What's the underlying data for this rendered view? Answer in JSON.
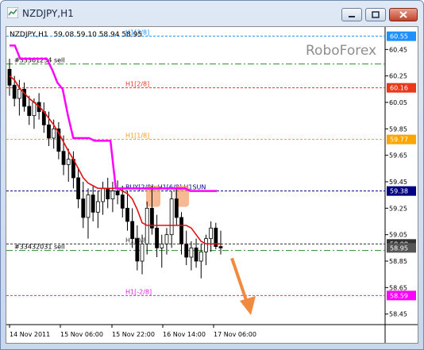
{
  "window": {
    "title": "NZDJPY,H1"
  },
  "chart_header": {
    "symbol": "NZDJPY,H1",
    "ohlc": "59.08 59.10 58.94 58.95"
  },
  "watermark": "RoboForex",
  "orders": [
    {
      "label": "#33361234 sell",
      "price": 60.34
    },
    {
      "label": "#33432031 sell",
      "price": 58.93
    }
  ],
  "levels": [
    {
      "label": "H1[3/8]",
      "price": 60.55,
      "color": "#1e90ff"
    },
    {
      "label": "H1[2/8]",
      "price": 60.16,
      "color": "#e8391d"
    },
    {
      "label": "H1[1/8]",
      "price": 59.77,
      "color": "#ff9a1a"
    },
    {
      "label": "BUY[2/8]: H1[6/8]  H1SUN",
      "price": 59.38,
      "color": "#00008b"
    },
    {
      "label": "H1[0/8]",
      "price": 58.98,
      "color": "#333333"
    },
    {
      "label": "H1[-2/8]",
      "price": 58.59,
      "color": "#e020e0"
    }
  ],
  "price_badges": [
    {
      "text": "60.55",
      "color": "#1e90ff"
    },
    {
      "text": "60.16",
      "color": "#e8391d"
    },
    {
      "text": "59.77",
      "color": "#ffa500"
    },
    {
      "text": "59.38",
      "color": "#000080"
    },
    {
      "text": "58.98",
      "color": "#333333"
    },
    {
      "text": "58.95",
      "color": "#555555"
    },
    {
      "text": "58.59",
      "color": "#ff00ff"
    }
  ],
  "chart_data": {
    "type": "candlestick",
    "symbol": "NZDJPY",
    "timeframe": "H1",
    "y_ticks": [
      "60.45",
      "60.25",
      "60.05",
      "59.85",
      "59.65",
      "59.45",
      "59.25",
      "59.05",
      "58.85",
      "58.65",
      "58.45"
    ],
    "y_tick_values": [
      60.45,
      60.25,
      60.05,
      59.85,
      59.65,
      59.45,
      59.25,
      59.05,
      58.85,
      58.65,
      58.45
    ],
    "ylim": [
      58.37,
      60.62
    ],
    "x_ticks": [
      "14 Nov 2011",
      "15 Nov 06:00",
      "15 Nov 22:00",
      "16 Nov 14:00",
      "17 Nov 06:00"
    ],
    "candles": [
      {
        "o": 60.3,
        "h": 60.38,
        "l": 60.1,
        "c": 60.18
      },
      {
        "o": 60.18,
        "h": 60.25,
        "l": 60.02,
        "c": 60.08
      },
      {
        "o": 60.08,
        "h": 60.22,
        "l": 59.95,
        "c": 60.15
      },
      {
        "o": 60.15,
        "h": 60.2,
        "l": 59.98,
        "c": 60.02
      },
      {
        "o": 60.02,
        "h": 60.1,
        "l": 59.88,
        "c": 59.95
      },
      {
        "o": 59.95,
        "h": 60.08,
        "l": 59.85,
        "c": 60.05
      },
      {
        "o": 60.05,
        "h": 60.12,
        "l": 59.92,
        "c": 59.98
      },
      {
        "o": 59.98,
        "h": 60.05,
        "l": 59.82,
        "c": 59.88
      },
      {
        "o": 59.88,
        "h": 59.98,
        "l": 59.72,
        "c": 59.78
      },
      {
        "o": 59.78,
        "h": 59.92,
        "l": 59.7,
        "c": 59.85
      },
      {
        "o": 59.85,
        "h": 59.9,
        "l": 59.62,
        "c": 59.68
      },
      {
        "o": 59.68,
        "h": 59.8,
        "l": 59.5,
        "c": 59.58
      },
      {
        "o": 59.58,
        "h": 59.7,
        "l": 59.45,
        "c": 59.62
      },
      {
        "o": 59.62,
        "h": 59.68,
        "l": 59.4,
        "c": 59.48
      },
      {
        "o": 59.48,
        "h": 59.55,
        "l": 59.25,
        "c": 59.32
      },
      {
        "o": 59.32,
        "h": 59.45,
        "l": 59.1,
        "c": 59.18
      },
      {
        "o": 59.18,
        "h": 59.4,
        "l": 59.02,
        "c": 59.35
      },
      {
        "o": 59.35,
        "h": 59.42,
        "l": 59.15,
        "c": 59.22
      },
      {
        "o": 59.22,
        "h": 59.38,
        "l": 59.1,
        "c": 59.3
      },
      {
        "o": 59.3,
        "h": 59.45,
        "l": 59.2,
        "c": 59.4
      },
      {
        "o": 59.4,
        "h": 59.48,
        "l": 59.25,
        "c": 59.32
      },
      {
        "o": 59.32,
        "h": 59.45,
        "l": 59.22,
        "c": 59.38
      },
      {
        "o": 59.38,
        "h": 59.46,
        "l": 59.28,
        "c": 59.35
      },
      {
        "o": 59.35,
        "h": 59.42,
        "l": 59.18,
        "c": 59.25
      },
      {
        "o": 59.25,
        "h": 59.38,
        "l": 59.08,
        "c": 59.15
      },
      {
        "o": 59.15,
        "h": 59.25,
        "l": 58.95,
        "c": 59.02
      },
      {
        "o": 59.02,
        "h": 59.12,
        "l": 58.78,
        "c": 58.85
      },
      {
        "o": 58.85,
        "h": 59.05,
        "l": 58.75,
        "c": 58.98
      },
      {
        "o": 58.98,
        "h": 59.3,
        "l": 58.9,
        "c": 59.25
      },
      {
        "o": 59.25,
        "h": 59.42,
        "l": 59.05,
        "c": 59.1
      },
      {
        "o": 59.1,
        "h": 59.2,
        "l": 58.88,
        "c": 58.95
      },
      {
        "o": 58.95,
        "h": 59.05,
        "l": 58.8,
        "c": 58.98
      },
      {
        "o": 58.98,
        "h": 59.1,
        "l": 58.9,
        "c": 59.05
      },
      {
        "o": 59.05,
        "h": 59.38,
        "l": 58.95,
        "c": 59.32
      },
      {
        "o": 59.32,
        "h": 59.4,
        "l": 59.12,
        "c": 59.18
      },
      {
        "o": 59.18,
        "h": 59.22,
        "l": 58.9,
        "c": 58.98
      },
      {
        "o": 58.98,
        "h": 59.08,
        "l": 58.82,
        "c": 58.88
      },
      {
        "o": 58.88,
        "h": 59.0,
        "l": 58.78,
        "c": 58.95
      },
      {
        "o": 58.95,
        "h": 59.02,
        "l": 58.8,
        "c": 58.85
      },
      {
        "o": 58.85,
        "h": 58.98,
        "l": 58.72,
        "c": 58.92
      },
      {
        "o": 58.92,
        "h": 59.05,
        "l": 58.82,
        "c": 59.02
      },
      {
        "o": 59.02,
        "h": 59.15,
        "l": 58.92,
        "c": 59.1
      },
      {
        "o": 59.1,
        "h": 59.14,
        "l": 58.94,
        "c": 58.96
      },
      {
        "o": 58.96,
        "h": 59.08,
        "l": 58.9,
        "c": 58.95
      }
    ],
    "ma_red": [
      60.25,
      60.22,
      60.16,
      60.12,
      60.08,
      60.05,
      60.02,
      59.98,
      59.93,
      59.88,
      59.82,
      59.75,
      59.68,
      59.62,
      59.55,
      59.48,
      59.44,
      59.42,
      59.4,
      59.4,
      59.4,
      59.4,
      59.4,
      59.38,
      59.36,
      59.32,
      59.24,
      59.14,
      59.12,
      59.12,
      59.12,
      59.12,
      59.12,
      59.12,
      59.12,
      59.12,
      59.12,
      59.1,
      59.05,
      59.0,
      58.98,
      58.98,
      58.98,
      58.98
    ],
    "ma_magenta": [
      60.48,
      60.48,
      60.38,
      60.38,
      60.38,
      60.38,
      60.38,
      60.38,
      60.3,
      60.2,
      60.15,
      59.95,
      59.78,
      59.78,
      59.78,
      59.78,
      59.76,
      59.76,
      59.76,
      59.76,
      59.4,
      59.4,
      59.4,
      59.4,
      59.4,
      59.4,
      59.4,
      59.4,
      59.4,
      59.4,
      59.4,
      59.4,
      59.4,
      59.4,
      59.38,
      59.38,
      59.38,
      59.38,
      59.38,
      59.38
    ],
    "highlights": [
      {
        "from": 59.26,
        "to": 59.42
      },
      {
        "from": 59.26,
        "to": 59.42
      }
    ],
    "forecast_arrow": {
      "from": 58.92,
      "to": 58.43
    }
  }
}
